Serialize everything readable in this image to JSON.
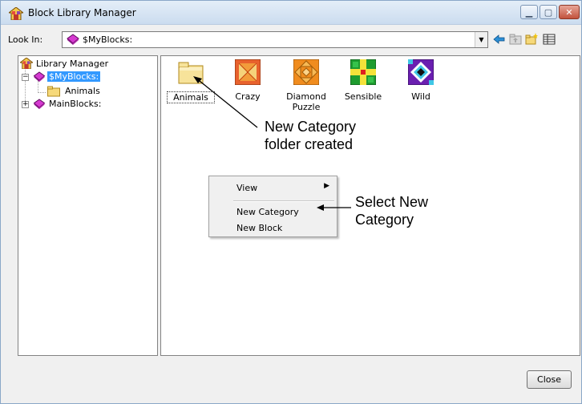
{
  "window": {
    "title": "Block Library Manager",
    "icon": "library-house-icon",
    "controls": [
      "minimize",
      "maximize",
      "close"
    ]
  },
  "toolbar": {
    "look_in_label": "Look In:",
    "look_in_value": "$MyBlocks:",
    "icons": [
      "back-arrow-icon",
      "up-folder-icon",
      "new-folder-icon",
      "view-menu-icon"
    ]
  },
  "tree": {
    "items": [
      {
        "label": "Library Manager",
        "icon": "library-house-icon",
        "level": 0
      },
      {
        "label": "$MyBlocks:",
        "icon": "book-icon",
        "level": 1,
        "expanded": true,
        "selected": true
      },
      {
        "label": "Animals",
        "icon": "folder-icon",
        "level": 2
      },
      {
        "label": "MainBlocks:",
        "icon": "book-icon",
        "level": 1,
        "expanded": false
      }
    ]
  },
  "blocks": [
    {
      "label": "Animals",
      "icon": "folder-icon",
      "focused": true
    },
    {
      "label": "Crazy",
      "icon": "crazy-block-icon"
    },
    {
      "label": "Diamond Puzzle",
      "icon": "diamond-puzzle-block-icon"
    },
    {
      "label": "Sensible",
      "icon": "sensible-block-icon"
    },
    {
      "label": "Wild",
      "icon": "wild-block-icon"
    }
  ],
  "context_menu": {
    "items": [
      {
        "label": "View",
        "submenu": true
      },
      {
        "label": "New Category"
      },
      {
        "label": "New Block"
      }
    ]
  },
  "annotations": {
    "folder_created": "New Category\nfolder created",
    "select_new_category": "Select New\nCategory"
  },
  "buttons": {
    "close": "Close"
  }
}
